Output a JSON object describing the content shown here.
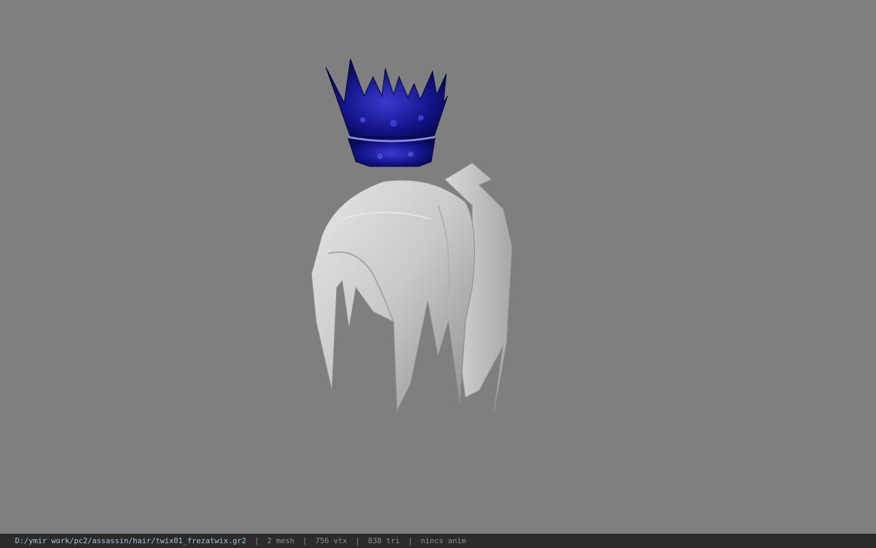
{
  "viewport": {
    "background": "#7f7f7f",
    "model": {
      "parts": [
        {
          "name": "crown",
          "color": "#1a1a8c"
        },
        {
          "name": "hair",
          "color": "#cfcfcf"
        }
      ]
    }
  },
  "statusbar": {
    "file_path": "D:/ymir work/pc2/assassin/hair/twix01_frezatwix.gr2",
    "mesh": "2 mesh",
    "vtx": "756 vtx",
    "tri": "838 tri",
    "anim": "nincs anim",
    "separator": "|"
  }
}
